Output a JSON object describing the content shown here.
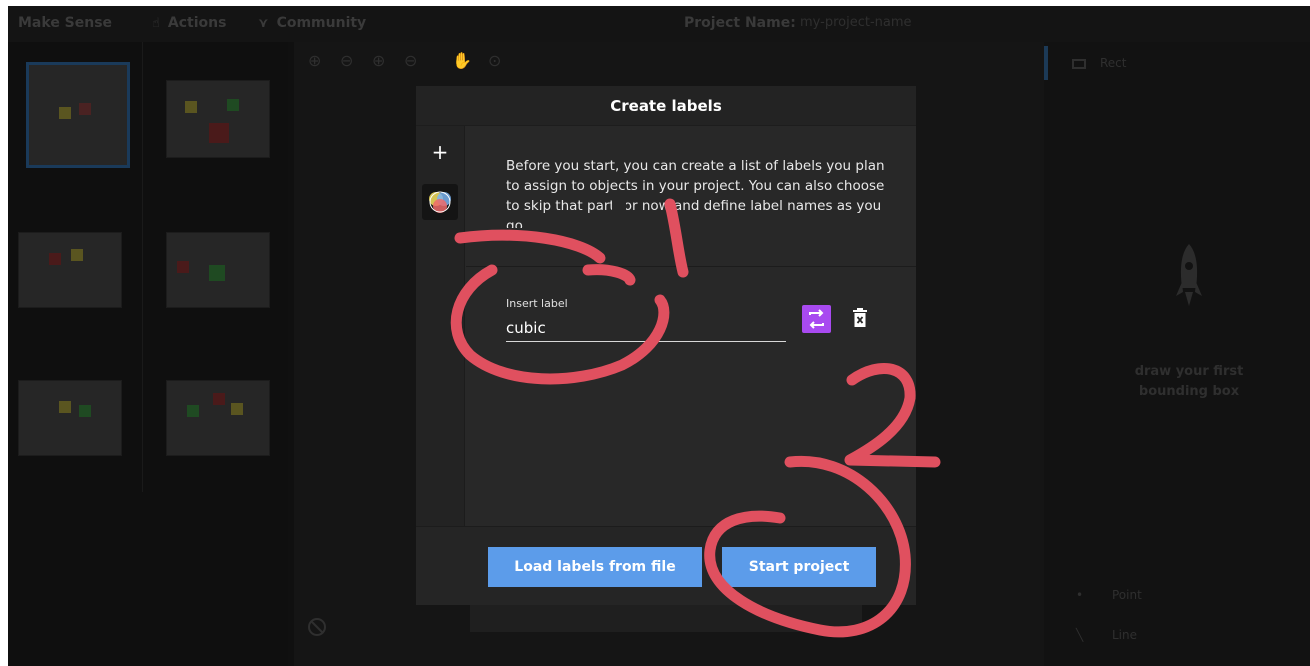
{
  "app": {
    "brand": "Make Sense",
    "nav": [
      {
        "label": "Actions",
        "icon": "hand-icon"
      },
      {
        "label": "Community",
        "icon": "users-icon"
      }
    ],
    "project_name_label": "Project Name:",
    "project_name_value": "my-project-name"
  },
  "right_panel": {
    "tool_label": "Rect",
    "empty_message": "draw your first bounding box",
    "items": [
      "Point",
      "Line"
    ]
  },
  "modal": {
    "title": "Create labels",
    "intro": "Before you start, you can create a list of labels you plan to assign to objects in your project. You can also choose to skip that part for now and define label names as you go.",
    "add_icon": "+",
    "input_label": "Insert label",
    "input_value": "cubic",
    "label_color": "#a84af0",
    "load_button": "Load labels from file",
    "start_button": "Start project"
  },
  "annotations": {
    "marks": [
      "1",
      "2"
    ],
    "ink_color": "#e0505f"
  }
}
